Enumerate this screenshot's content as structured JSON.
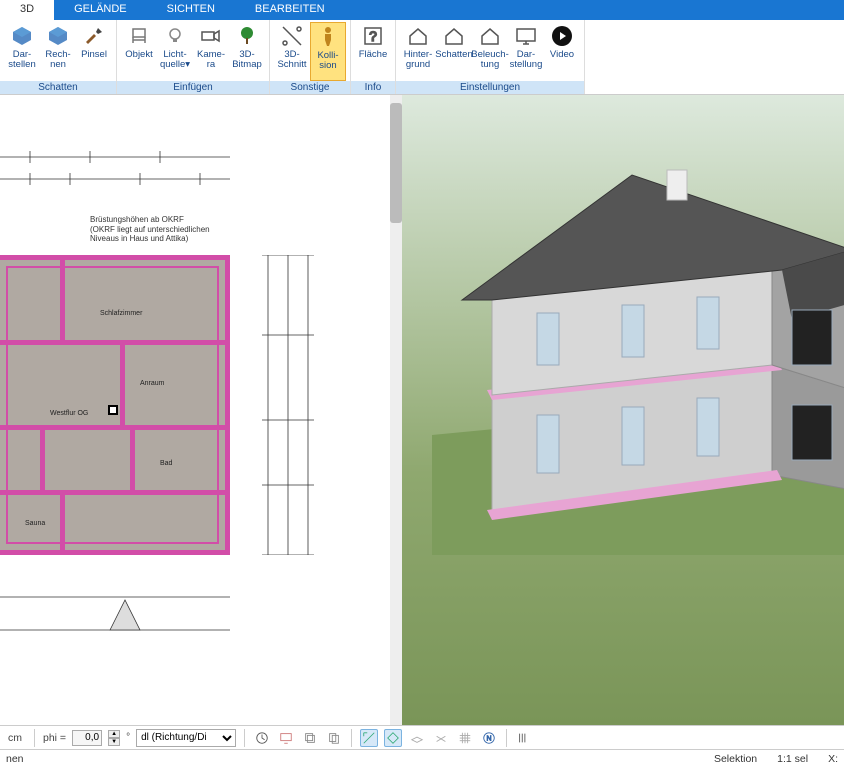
{
  "tabs": {
    "items": [
      "3D",
      "GELÄNDE",
      "SICHTEN",
      "BEARBEITEN"
    ],
    "active": 0
  },
  "ribbon": {
    "groups": [
      {
        "label": "Schatten",
        "buttons": [
          {
            "label_1": "Dar-",
            "label_2": "stellen",
            "icon": "cube",
            "name": "darstellen-button"
          },
          {
            "label_1": "Rech-",
            "label_2": "nen",
            "icon": "cube",
            "name": "rechnen-button"
          },
          {
            "label_1": "Pinsel",
            "label_2": "",
            "icon": "brush",
            "name": "pinsel-button"
          }
        ]
      },
      {
        "label": "Einfügen",
        "buttons": [
          {
            "label_1": "Objekt",
            "label_2": "",
            "icon": "chair",
            "name": "objekt-button"
          },
          {
            "label_1": "Licht-",
            "label_2": "quelle▾",
            "icon": "bulb",
            "name": "lichtquelle-button"
          },
          {
            "label_1": "Kame-",
            "label_2": "ra",
            "icon": "camera",
            "name": "kamera-button"
          },
          {
            "label_1": "3D-",
            "label_2": "Bitmap",
            "icon": "tree",
            "name": "3d-bitmap-button"
          }
        ]
      },
      {
        "label": "Sonstige",
        "buttons": [
          {
            "label_1": "3D-",
            "label_2": "Schnitt",
            "icon": "slice",
            "name": "3d-schnitt-button"
          },
          {
            "label_1": "Kolli-",
            "label_2": "sion",
            "icon": "person",
            "name": "kollision-button",
            "selected": true
          }
        ]
      },
      {
        "label": "Info",
        "buttons": [
          {
            "label_1": "Fläche",
            "label_2": "",
            "icon": "question",
            "name": "flaeche-button"
          }
        ]
      },
      {
        "label": "Einstellungen",
        "buttons": [
          {
            "label_1": "Hinter-",
            "label_2": "grund",
            "icon": "house",
            "name": "hintergrund-button"
          },
          {
            "label_1": "Schatten",
            "label_2": "",
            "icon": "house",
            "name": "schatten-settings-button"
          },
          {
            "label_1": "Beleuch-",
            "label_2": "tung",
            "icon": "house",
            "name": "beleuchtung-button"
          },
          {
            "label_1": "Dar-",
            "label_2": "stellung",
            "icon": "screen",
            "name": "darstellung-button"
          },
          {
            "label_1": "Video",
            "label_2": "",
            "icon": "play",
            "name": "video-button"
          }
        ]
      }
    ]
  },
  "plan": {
    "note_line1": "Brüstungshöhen ab OKRF",
    "note_line2": "(OKRF liegt auf unterschiedlichen",
    "note_line3": "Niveaus in Haus und Attika)",
    "rooms": [
      "Schlafzimmer",
      "Anraum",
      "Westflur OG",
      "Bad",
      "Sauna"
    ]
  },
  "toolbar": {
    "unit": "cm",
    "phi_label": "phi =",
    "phi_value": "0,0",
    "deg": "°",
    "direction_label": "dl (Richtung/Di"
  },
  "statusbar": {
    "left": "nen",
    "selektion": "Selektion",
    "ratio": "1:1 sel",
    "x": "X:"
  }
}
